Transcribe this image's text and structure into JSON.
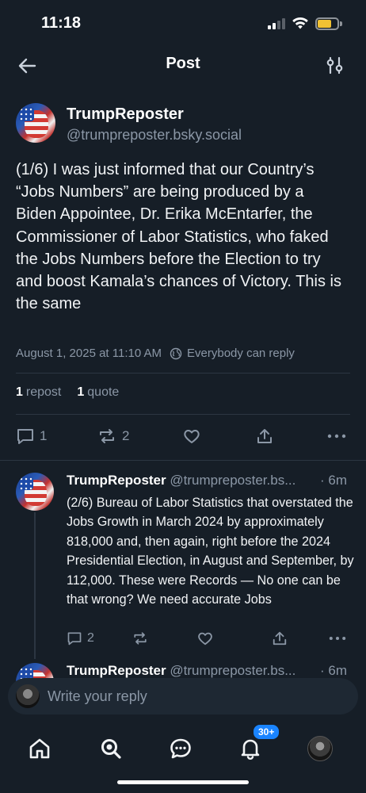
{
  "status_bar": {
    "time": "11:18"
  },
  "header": {
    "title": "Post",
    "back_icon": "arrow-left-icon",
    "filter_icon": "sliders-icon"
  },
  "main_post": {
    "author_name": "TrumpReposter",
    "author_handle": "@trumpreposter.bsky.social",
    "text": "(1/6) I was just informed that our Country’s “Jobs Numbers” are being produced by a Biden Appointee, Dr. Erika McEntarfer, the Commissioner of Labor Statistics, who faked the Jobs Numbers before the Election to try and boost Kamala’s chances of Victory. This is the same",
    "timestamp": "August 1, 2025 at 11:10 AM",
    "reply_setting": "Everybody can reply",
    "reposts_count": "1",
    "reposts_label": "repost",
    "quotes_count": "1",
    "quotes_label": "quote",
    "reply_count": "1",
    "repost_count_action": "2"
  },
  "reply_post": {
    "author_name": "TrumpReposter",
    "author_handle": "@trumpreposter.bs...",
    "time_ago": "· 6m",
    "text": "(2/6) Bureau of Labor Statistics that overstated the Jobs Growth in March 2024 by approximately 818,000 and, then again, right before the 2024 Presidential Election, in August and September, by 112,000. These were Records — No one can be that wrong? We need accurate Jobs",
    "reply_count": "2"
  },
  "next_post": {
    "author_name": "TrumpReposter",
    "author_handle": "@trumpreposter.bs...",
    "time_ago": "· 6m"
  },
  "composer": {
    "placeholder": "Write your reply"
  },
  "bottom_nav": {
    "notifications_badge": "30+"
  },
  "colors": {
    "background": "#161e27",
    "muted": "#8b97a6",
    "accent": "#1a84ff",
    "battery": "#f2c233"
  }
}
